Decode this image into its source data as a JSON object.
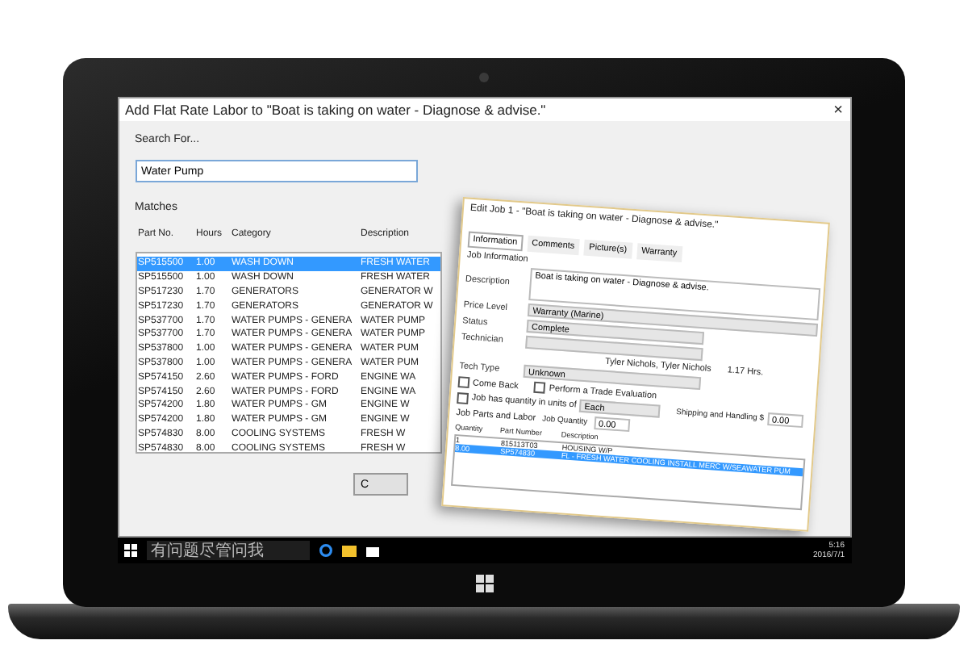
{
  "dialog": {
    "title": "Add Flat Rate Labor to \"Boat is taking on water - Diagnose & advise.\"",
    "close": "×",
    "search_label": "Search For...",
    "search_value": "Water Pump",
    "matches_label": "Matches",
    "columns": [
      "Part No.",
      "Hours",
      "Category",
      "Description"
    ],
    "rows": [
      {
        "part": "SP515500",
        "hours": "1.00",
        "category": "WASH DOWN",
        "description": "FRESH WATER",
        "selected": true
      },
      {
        "part": "SP515500",
        "hours": "1.00",
        "category": "WASH DOWN",
        "description": "FRESH WATER",
        "selected": false
      },
      {
        "part": "SP517230",
        "hours": "1.70",
        "category": "GENERATORS",
        "description": "GENERATOR W",
        "selected": false
      },
      {
        "part": "SP517230",
        "hours": "1.70",
        "category": "GENERATORS",
        "description": "GENERATOR W",
        "selected": false
      },
      {
        "part": "SP537700",
        "hours": "1.70",
        "category": "WATER PUMPS - GENERA",
        "description": "WATER PUMP",
        "selected": false
      },
      {
        "part": "SP537700",
        "hours": "1.70",
        "category": "WATER PUMPS - GENERA",
        "description": "WATER PUMP",
        "selected": false
      },
      {
        "part": "SP537800",
        "hours": "1.00",
        "category": "WATER PUMPS - GENERA",
        "description": "WATER PUM",
        "selected": false
      },
      {
        "part": "SP537800",
        "hours": "1.00",
        "category": "WATER PUMPS - GENERA",
        "description": "WATER PUM",
        "selected": false
      },
      {
        "part": "SP574150",
        "hours": "2.60",
        "category": "WATER PUMPS - FORD",
        "description": "ENGINE WA",
        "selected": false
      },
      {
        "part": "SP574150",
        "hours": "2.60",
        "category": "WATER PUMPS - FORD",
        "description": "ENGINE WA",
        "selected": false
      },
      {
        "part": "SP574200",
        "hours": "1.80",
        "category": "WATER PUMPS - GM",
        "description": "ENGINE W",
        "selected": false
      },
      {
        "part": "SP574200",
        "hours": "1.80",
        "category": "WATER PUMPS - GM",
        "description": "ENGINE W",
        "selected": false
      },
      {
        "part": "SP574830",
        "hours": "8.00",
        "category": "COOLING SYSTEMS",
        "description": "FRESH W",
        "selected": false
      },
      {
        "part": "SP574830",
        "hours": "8.00",
        "category": "COOLING SYSTEMS",
        "description": "FRESH W",
        "selected": false
      }
    ],
    "button": "C"
  },
  "edit_job": {
    "title": "Edit Job 1 - \"Boat is taking on water - Diagnose & advise.\"",
    "tabs": [
      {
        "label": "Information",
        "selected": true
      },
      {
        "label": "Comments",
        "selected": false
      },
      {
        "label": "Picture(s)",
        "selected": false
      },
      {
        "label": "Warranty",
        "selected": false
      }
    ],
    "group": "Job Information",
    "description_label": "Description",
    "description": "Boat is taking on water - Diagnose & advise.",
    "price_level_label": "Price Level",
    "price_level": "Warranty (Marine)",
    "status_label": "Status",
    "status": "Complete",
    "technician_label": "Technician",
    "technicians": "Tyler Nichols, Tyler Nichols",
    "hours": "1.17 Hrs.",
    "tech_type_label": "Tech Type",
    "tech_type": "Unknown",
    "checkboxes": [
      {
        "label": "Come Back",
        "checked": false
      },
      {
        "label": "Perform a Trade Evaluation",
        "checked": false
      }
    ],
    "units": {
      "label": "Job has quantity in units of",
      "checked": false,
      "value": "Each"
    },
    "shipping_label": "Shipping and Handling $",
    "shipping": "0.00",
    "job_quantity_label": "Job Quantity",
    "job_quantity": "0.00",
    "parts_label": "Job Parts and Labor",
    "parts_columns": [
      "Quantity",
      "Part Number",
      "Description"
    ],
    "parts": [
      {
        "quantity": "1",
        "part": "815113T03",
        "description": "HOUSING W/P",
        "selected": false
      },
      {
        "quantity": "8.00",
        "part": "SP574830",
        "description": "FL - FRESH WATER COOLING INSTALL MERC W/SEAWATER PUM",
        "selected": true
      }
    ]
  },
  "taskbar": {
    "search_placeholder": "有问题尽管问我",
    "time": "5:16",
    "date": "2016/7/1"
  }
}
